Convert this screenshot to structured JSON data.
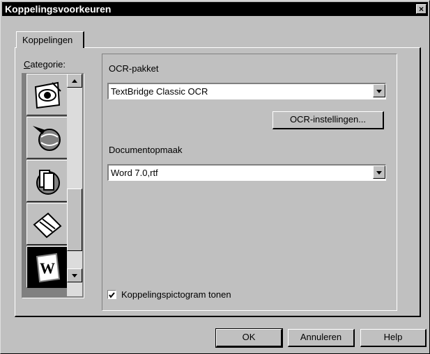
{
  "window": {
    "title": "Koppelingsvoorkeuren",
    "close_glyph": "×"
  },
  "tabs": [
    {
      "label": "Koppelingen",
      "active": true
    }
  ],
  "category": {
    "label": "Categorie:",
    "items": [
      {
        "icon": "eye-scanner-icon",
        "selected": false
      },
      {
        "icon": "pen-globe-icon",
        "selected": false
      },
      {
        "icon": "documents-stack-icon",
        "selected": false
      },
      {
        "icon": "envelope-edit-icon",
        "selected": false
      },
      {
        "icon": "word-document-icon",
        "selected": true
      }
    ]
  },
  "ocr": {
    "label": "OCR-pakket",
    "value": "TextBridge Classic OCR",
    "settings_button": "OCR-instellingen..."
  },
  "document": {
    "label": "Documentopmaak",
    "value": "Word 7.0,rtf"
  },
  "show_icon": {
    "label": "Koppelingspictogram tonen",
    "checked": true
  },
  "footer": {
    "ok": "OK",
    "cancel": "Annuleren",
    "help": "Help"
  }
}
